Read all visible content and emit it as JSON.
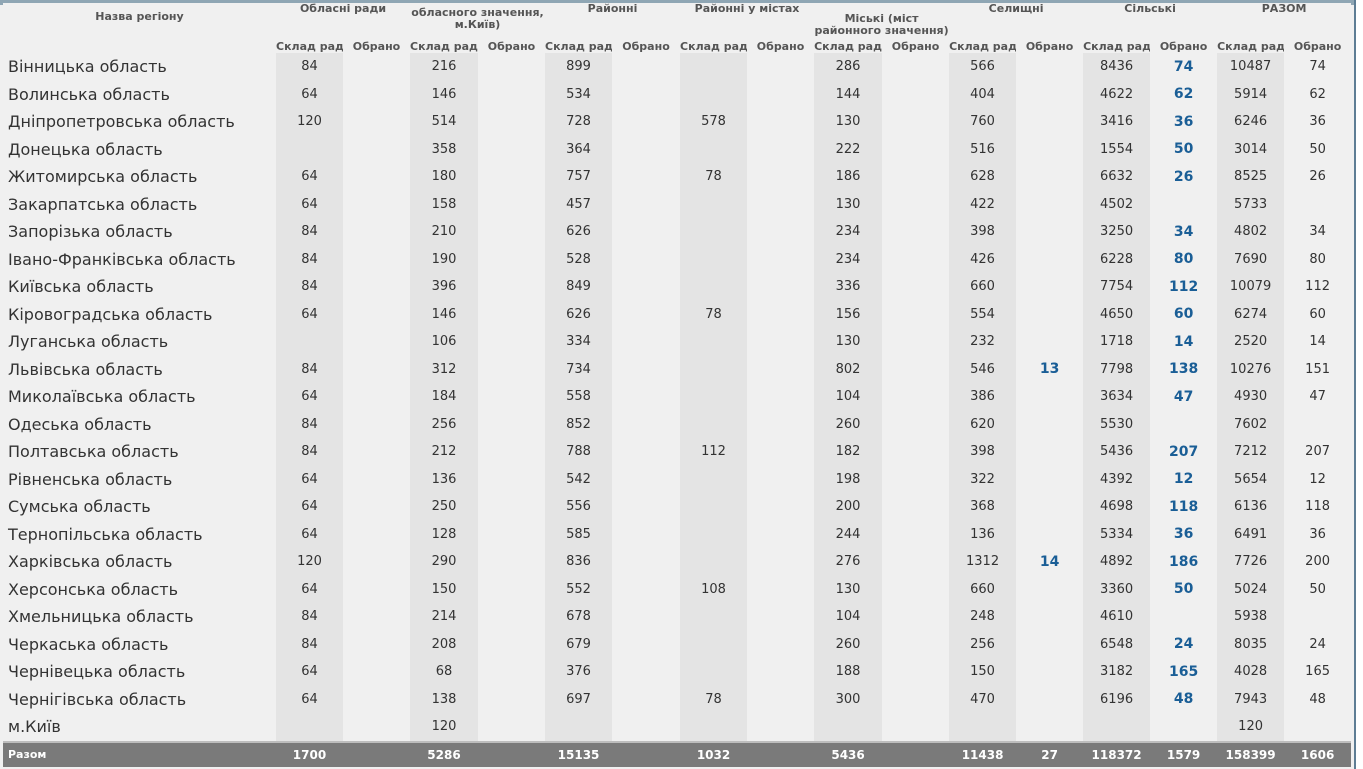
{
  "table": {
    "headers": {
      "region": "Назва регіону",
      "groups": [
        {
          "label": "Обласні ради"
        },
        {
          "label": "обласного значення, м.Київ)"
        },
        {
          "label": "Районні"
        },
        {
          "label": "Районні у містах"
        },
        {
          "label": "Міські (міст районного значення)"
        },
        {
          "label": "Селищні"
        },
        {
          "label": "Сільські"
        },
        {
          "label": "РАЗОМ"
        }
      ],
      "sub_seats": "Склад рад",
      "sub_elected": "Обрано"
    },
    "rows": [
      {
        "name": "Вінницька область",
        "vals": [
          "84",
          "",
          "216",
          "",
          "899",
          "",
          "",
          "",
          "286",
          "",
          "566",
          "",
          "8436",
          "74",
          "10487",
          "74"
        ]
      },
      {
        "name": "Волинська область",
        "vals": [
          "64",
          "",
          "146",
          "",
          "534",
          "",
          "",
          "",
          "144",
          "",
          "404",
          "",
          "4622",
          "62",
          "5914",
          "62"
        ]
      },
      {
        "name": "Дніпропетровська область",
        "vals": [
          "120",
          "",
          "514",
          "",
          "728",
          "",
          "578",
          "",
          "130",
          "",
          "760",
          "",
          "3416",
          "36",
          "6246",
          "36"
        ]
      },
      {
        "name": "Донецька область",
        "vals": [
          "",
          "",
          "358",
          "",
          "364",
          "",
          "",
          "",
          "222",
          "",
          "516",
          "",
          "1554",
          "50",
          "3014",
          "50"
        ]
      },
      {
        "name": "Житомирська область",
        "vals": [
          "64",
          "",
          "180",
          "",
          "757",
          "",
          "78",
          "",
          "186",
          "",
          "628",
          "",
          "6632",
          "26",
          "8525",
          "26"
        ]
      },
      {
        "name": "Закарпатська область",
        "vals": [
          "64",
          "",
          "158",
          "",
          "457",
          "",
          "",
          "",
          "130",
          "",
          "422",
          "",
          "4502",
          "",
          "5733",
          ""
        ]
      },
      {
        "name": "Запорізька область",
        "vals": [
          "84",
          "",
          "210",
          "",
          "626",
          "",
          "",
          "",
          "234",
          "",
          "398",
          "",
          "3250",
          "34",
          "4802",
          "34"
        ]
      },
      {
        "name": "Івано-Франківська область",
        "vals": [
          "84",
          "",
          "190",
          "",
          "528",
          "",
          "",
          "",
          "234",
          "",
          "426",
          "",
          "6228",
          "80",
          "7690",
          "80"
        ]
      },
      {
        "name": "Київська область",
        "vals": [
          "84",
          "",
          "396",
          "",
          "849",
          "",
          "",
          "",
          "336",
          "",
          "660",
          "",
          "7754",
          "112",
          "10079",
          "112"
        ]
      },
      {
        "name": "Кіровоградська область",
        "vals": [
          "64",
          "",
          "146",
          "",
          "626",
          "",
          "78",
          "",
          "156",
          "",
          "554",
          "",
          "4650",
          "60",
          "6274",
          "60"
        ]
      },
      {
        "name": "Луганська область",
        "vals": [
          "",
          "",
          "106",
          "",
          "334",
          "",
          "",
          "",
          "130",
          "",
          "232",
          "",
          "1718",
          "14",
          "2520",
          "14"
        ]
      },
      {
        "name": "Львівська область",
        "vals": [
          "84",
          "",
          "312",
          "",
          "734",
          "",
          "",
          "",
          "802",
          "",
          "546",
          "13",
          "7798",
          "138",
          "10276",
          "151"
        ]
      },
      {
        "name": "Миколаївська область",
        "vals": [
          "64",
          "",
          "184",
          "",
          "558",
          "",
          "",
          "",
          "104",
          "",
          "386",
          "",
          "3634",
          "47",
          "4930",
          "47"
        ]
      },
      {
        "name": "Одеська область",
        "vals": [
          "84",
          "",
          "256",
          "",
          "852",
          "",
          "",
          "",
          "260",
          "",
          "620",
          "",
          "5530",
          "",
          "7602",
          ""
        ]
      },
      {
        "name": "Полтавська область",
        "vals": [
          "84",
          "",
          "212",
          "",
          "788",
          "",
          "112",
          "",
          "182",
          "",
          "398",
          "",
          "5436",
          "207",
          "7212",
          "207"
        ]
      },
      {
        "name": "Рівненська область",
        "vals": [
          "64",
          "",
          "136",
          "",
          "542",
          "",
          "",
          "",
          "198",
          "",
          "322",
          "",
          "4392",
          "12",
          "5654",
          "12"
        ]
      },
      {
        "name": "Сумська область",
        "vals": [
          "64",
          "",
          "250",
          "",
          "556",
          "",
          "",
          "",
          "200",
          "",
          "368",
          "",
          "4698",
          "118",
          "6136",
          "118"
        ]
      },
      {
        "name": "Тернопільська область",
        "vals": [
          "64",
          "",
          "128",
          "",
          "585",
          "",
          "",
          "",
          "244",
          "",
          "136",
          "",
          "5334",
          "36",
          "6491",
          "36"
        ]
      },
      {
        "name": "Харківська область",
        "vals": [
          "120",
          "",
          "290",
          "",
          "836",
          "",
          "",
          "",
          "276",
          "",
          "1312",
          "14",
          "4892",
          "186",
          "7726",
          "200"
        ]
      },
      {
        "name": "Херсонська область",
        "vals": [
          "64",
          "",
          "150",
          "",
          "552",
          "",
          "108",
          "",
          "130",
          "",
          "660",
          "",
          "3360",
          "50",
          "5024",
          "50"
        ]
      },
      {
        "name": "Хмельницька область",
        "vals": [
          "84",
          "",
          "214",
          "",
          "678",
          "",
          "",
          "",
          "104",
          "",
          "248",
          "",
          "4610",
          "",
          "5938",
          ""
        ]
      },
      {
        "name": "Черкаська область",
        "vals": [
          "84",
          "",
          "208",
          "",
          "679",
          "",
          "",
          "",
          "260",
          "",
          "256",
          "",
          "6548",
          "24",
          "8035",
          "24"
        ]
      },
      {
        "name": "Чернівецька область",
        "vals": [
          "64",
          "",
          "68",
          "",
          "376",
          "",
          "",
          "",
          "188",
          "",
          "150",
          "",
          "3182",
          "165",
          "4028",
          "165"
        ]
      },
      {
        "name": "Чернігівська область",
        "vals": [
          "64",
          "",
          "138",
          "",
          "697",
          "",
          "78",
          "",
          "300",
          "",
          "470",
          "",
          "6196",
          "48",
          "7943",
          "48"
        ]
      },
      {
        "name": "м.Київ",
        "vals": [
          "",
          "",
          "120",
          "",
          "",
          "",
          "",
          "",
          "",
          "",
          "",
          "",
          "",
          "",
          "120",
          ""
        ]
      }
    ],
    "total": {
      "name": "Разом",
      "vals": [
        "1700",
        "",
        "5286",
        "",
        "15135",
        "",
        "1032",
        "",
        "5436",
        "",
        "11438",
        "27",
        "118372",
        "1579",
        "158399",
        "1606"
      ]
    }
  }
}
